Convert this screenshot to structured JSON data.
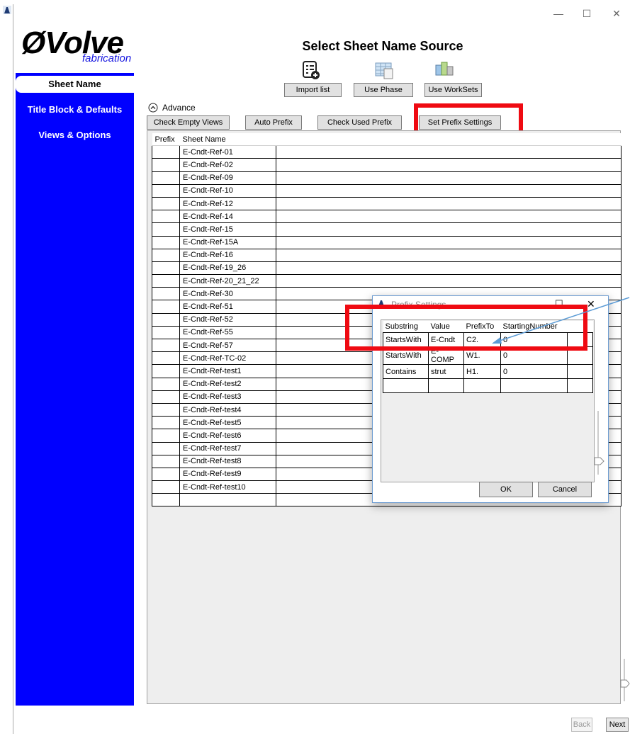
{
  "window": {
    "minimize": "—",
    "maximize": "☐",
    "close": "✕"
  },
  "logo": {
    "name": "ØVolve",
    "sub": "fabrication"
  },
  "sidebar": {
    "items": [
      {
        "label": "Sheet Name"
      },
      {
        "label": "Title Block & Defaults"
      },
      {
        "label": "Views & Options"
      }
    ]
  },
  "header": {
    "title": "Select Sheet Name Source"
  },
  "source_buttons": {
    "import": "Import list",
    "phase": "Use Phase",
    "worksets": "Use WorkSets"
  },
  "advance": {
    "label": "Advance"
  },
  "toolbar": {
    "check_empty": "Check Empty Views",
    "auto_prefix": "Auto Prefix",
    "check_used": "Check Used Prefix",
    "set_prefix": "Set Prefix Settings"
  },
  "grid": {
    "columns": [
      "Prefix",
      "Sheet Name"
    ],
    "rows": [
      "E-Cndt-Ref-01",
      "E-Cndt-Ref-02",
      "E-Cndt-Ref-09",
      "E-Cndt-Ref-10",
      "E-Cndt-Ref-12",
      "E-Cndt-Ref-14",
      "E-Cndt-Ref-15",
      "E-Cndt-Ref-15A",
      "E-Cndt-Ref-16",
      "E-Cndt-Ref-19_26",
      "E-Cndt-Ref-20_21_22",
      "E-Cndt-Ref-30",
      "E-Cndt-Ref-51",
      "E-Cndt-Ref-52",
      "E-Cndt-Ref-55",
      "E-Cndt-Ref-57",
      "E-Cndt-Ref-TC-02",
      "E-Cndt-Ref-test1",
      "E-Cndt-Ref-test2",
      "E-Cndt-Ref-test3",
      "E-Cndt-Ref-test4",
      "E-Cndt-Ref-test5",
      "E-Cndt-Ref-test6",
      "E-Cndt-Ref-test7",
      "E-Cndt-Ref-test8",
      "E-Cndt-Ref-test9",
      "E-Cndt-Ref-test10",
      ""
    ]
  },
  "dialog": {
    "title": "Prefix Settings",
    "columns": [
      "Substring",
      "Value",
      "PrefixTo",
      "StartingNumber"
    ],
    "rows": [
      [
        "StartsWith",
        "E-Cndt",
        "C2.",
        "0"
      ],
      [
        "StartsWith",
        "E-COMP",
        "W1.",
        "0"
      ],
      [
        "Contains",
        "strut",
        "H1.",
        "0"
      ],
      [
        "",
        "",
        "",
        ""
      ]
    ],
    "ok": "OK",
    "cancel": "Cancel",
    "maximize": "☐",
    "close": "✕"
  },
  "nav": {
    "back": "Back",
    "next": "Next"
  },
  "colors": {
    "sidebar": "#0000ff",
    "highlight": "#ef0a12",
    "arrow": "#5b9bd5"
  }
}
